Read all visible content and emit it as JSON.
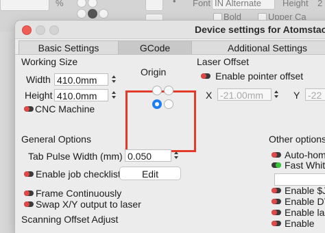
{
  "background": {
    "percent_sign": "%",
    "font_label": "Font",
    "font_value": "IN Alternate",
    "height_label": "Height",
    "height_value": "2",
    "bold_label": "Bold",
    "upper_case_label": "Upper Ca"
  },
  "window": {
    "title": "Device settings for Atomstack"
  },
  "tabs": [
    {
      "label": "Basic Settings"
    },
    {
      "label": "GCode"
    },
    {
      "label": "Additional Settings"
    }
  ],
  "working_size": {
    "heading": "Working Size",
    "width_label": "Width",
    "width_value": "410.0mm",
    "height_label": "Height",
    "height_value": "410.0mm",
    "cnc_label": "CNC Machine"
  },
  "origin": {
    "heading": "Origin",
    "selected": "bottom-left"
  },
  "laser_offset": {
    "heading": "Laser Offset",
    "pointer_label": "Enable pointer offset",
    "x_label": "X",
    "x_value": "-21.00mm",
    "y_label": "Y",
    "y_value": "-22"
  },
  "general": {
    "heading": "General Options",
    "tab_pulse_label": "Tab Pulse Width (mm)",
    "tab_pulse_value": "0.050",
    "job_checklist_label": "Enable job checklist",
    "edit_label": "Edit",
    "frame_label": "Frame Continuously",
    "swap_label": "Swap X/Y output to laser"
  },
  "scanning": {
    "heading": "Scanning Offset Adjust"
  },
  "other": {
    "heading": "Other options",
    "items": [
      {
        "label": "Auto-hom",
        "on": false
      },
      {
        "label": "Fast White",
        "on": true
      },
      {
        "label": "Enable $J",
        "on": false
      },
      {
        "label": "Enable DT",
        "on": false
      },
      {
        "label": "Enable las",
        "on": false
      },
      {
        "label": "Enable",
        "on": false
      }
    ]
  },
  "colors": {
    "toggle_off": "#e04848",
    "toggle_on": "#39c539",
    "radio_selected": "#1e7ef0",
    "highlight": "#e23b2a"
  }
}
